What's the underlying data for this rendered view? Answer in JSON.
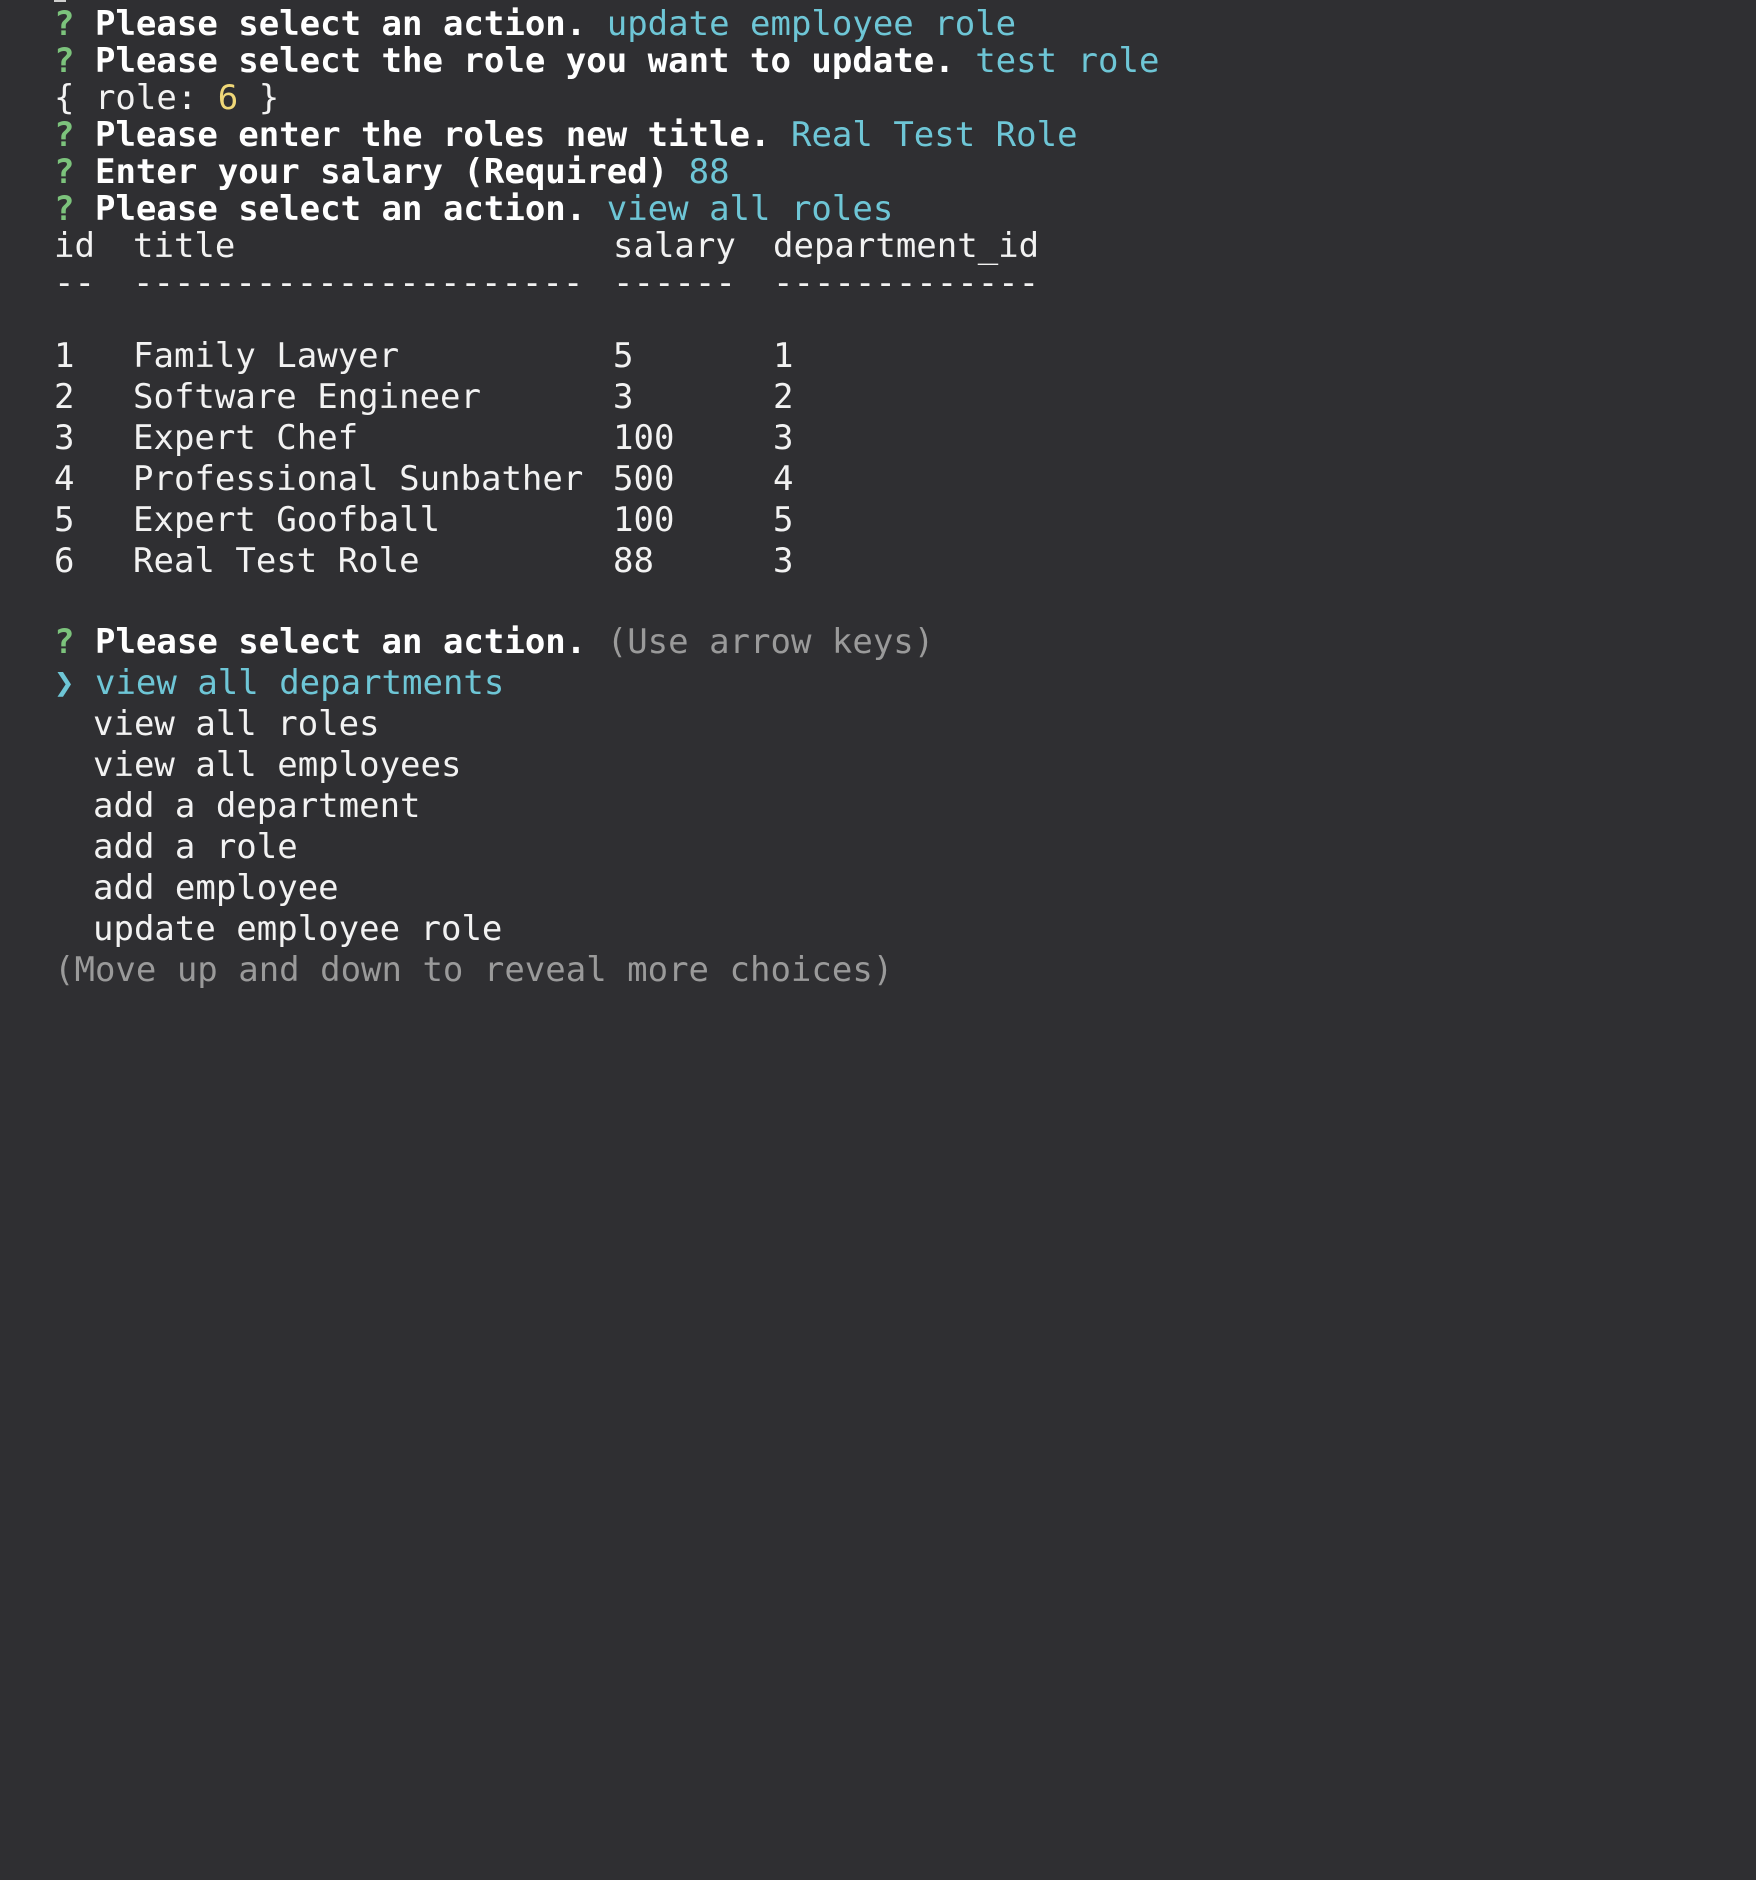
{
  "colors": {
    "background": "#2f2f32",
    "text": "#f2f2f2",
    "prompt_marker": "#7cc37c",
    "answer": "#6ec6d6",
    "number": "#f0d878",
    "hint": "#9a9a9a"
  },
  "history": [
    {
      "marker": "?",
      "question": "Please select an action.",
      "answer": "update employee role"
    },
    {
      "marker": "?",
      "question": "Please select the role you want to update.",
      "answer": "test role"
    }
  ],
  "debug_output": {
    "prefix": "{ role: ",
    "value": "6",
    "suffix": " }"
  },
  "history2": [
    {
      "marker": "?",
      "question": "Please enter the roles new title.",
      "answer": "Real Test Role"
    },
    {
      "marker": "?",
      "question": "Enter your salary (Required)",
      "answer": "88"
    },
    {
      "marker": "?",
      "question": "Please select an action.",
      "answer": "view all roles"
    }
  ],
  "table": {
    "headers": [
      "id",
      "title",
      "salary",
      "department_id"
    ],
    "separators": [
      "--",
      "----------------------",
      "------",
      "-------------"
    ],
    "rows": [
      [
        "1",
        "Family Lawyer",
        "5",
        "1"
      ],
      [
        "2",
        "Software Engineer",
        "3",
        "2"
      ],
      [
        "3",
        "Expert Chef",
        "100",
        "3"
      ],
      [
        "4",
        "Professional Sunbather",
        "500",
        "4"
      ],
      [
        "5",
        "Expert Goofball",
        "100",
        "5"
      ],
      [
        "6",
        "Real Test Role",
        "88",
        "3"
      ]
    ]
  },
  "prompt": {
    "marker": "?",
    "question": "Please select an action.",
    "hint": "(Use arrow keys)",
    "pointer": "❯",
    "choices": [
      "view all departments",
      "view all roles",
      "view all employees",
      "add a department",
      "add a role",
      "add employee",
      "update employee role"
    ],
    "selected_index": 0,
    "footer": "(Move up and down to reveal more choices)"
  }
}
